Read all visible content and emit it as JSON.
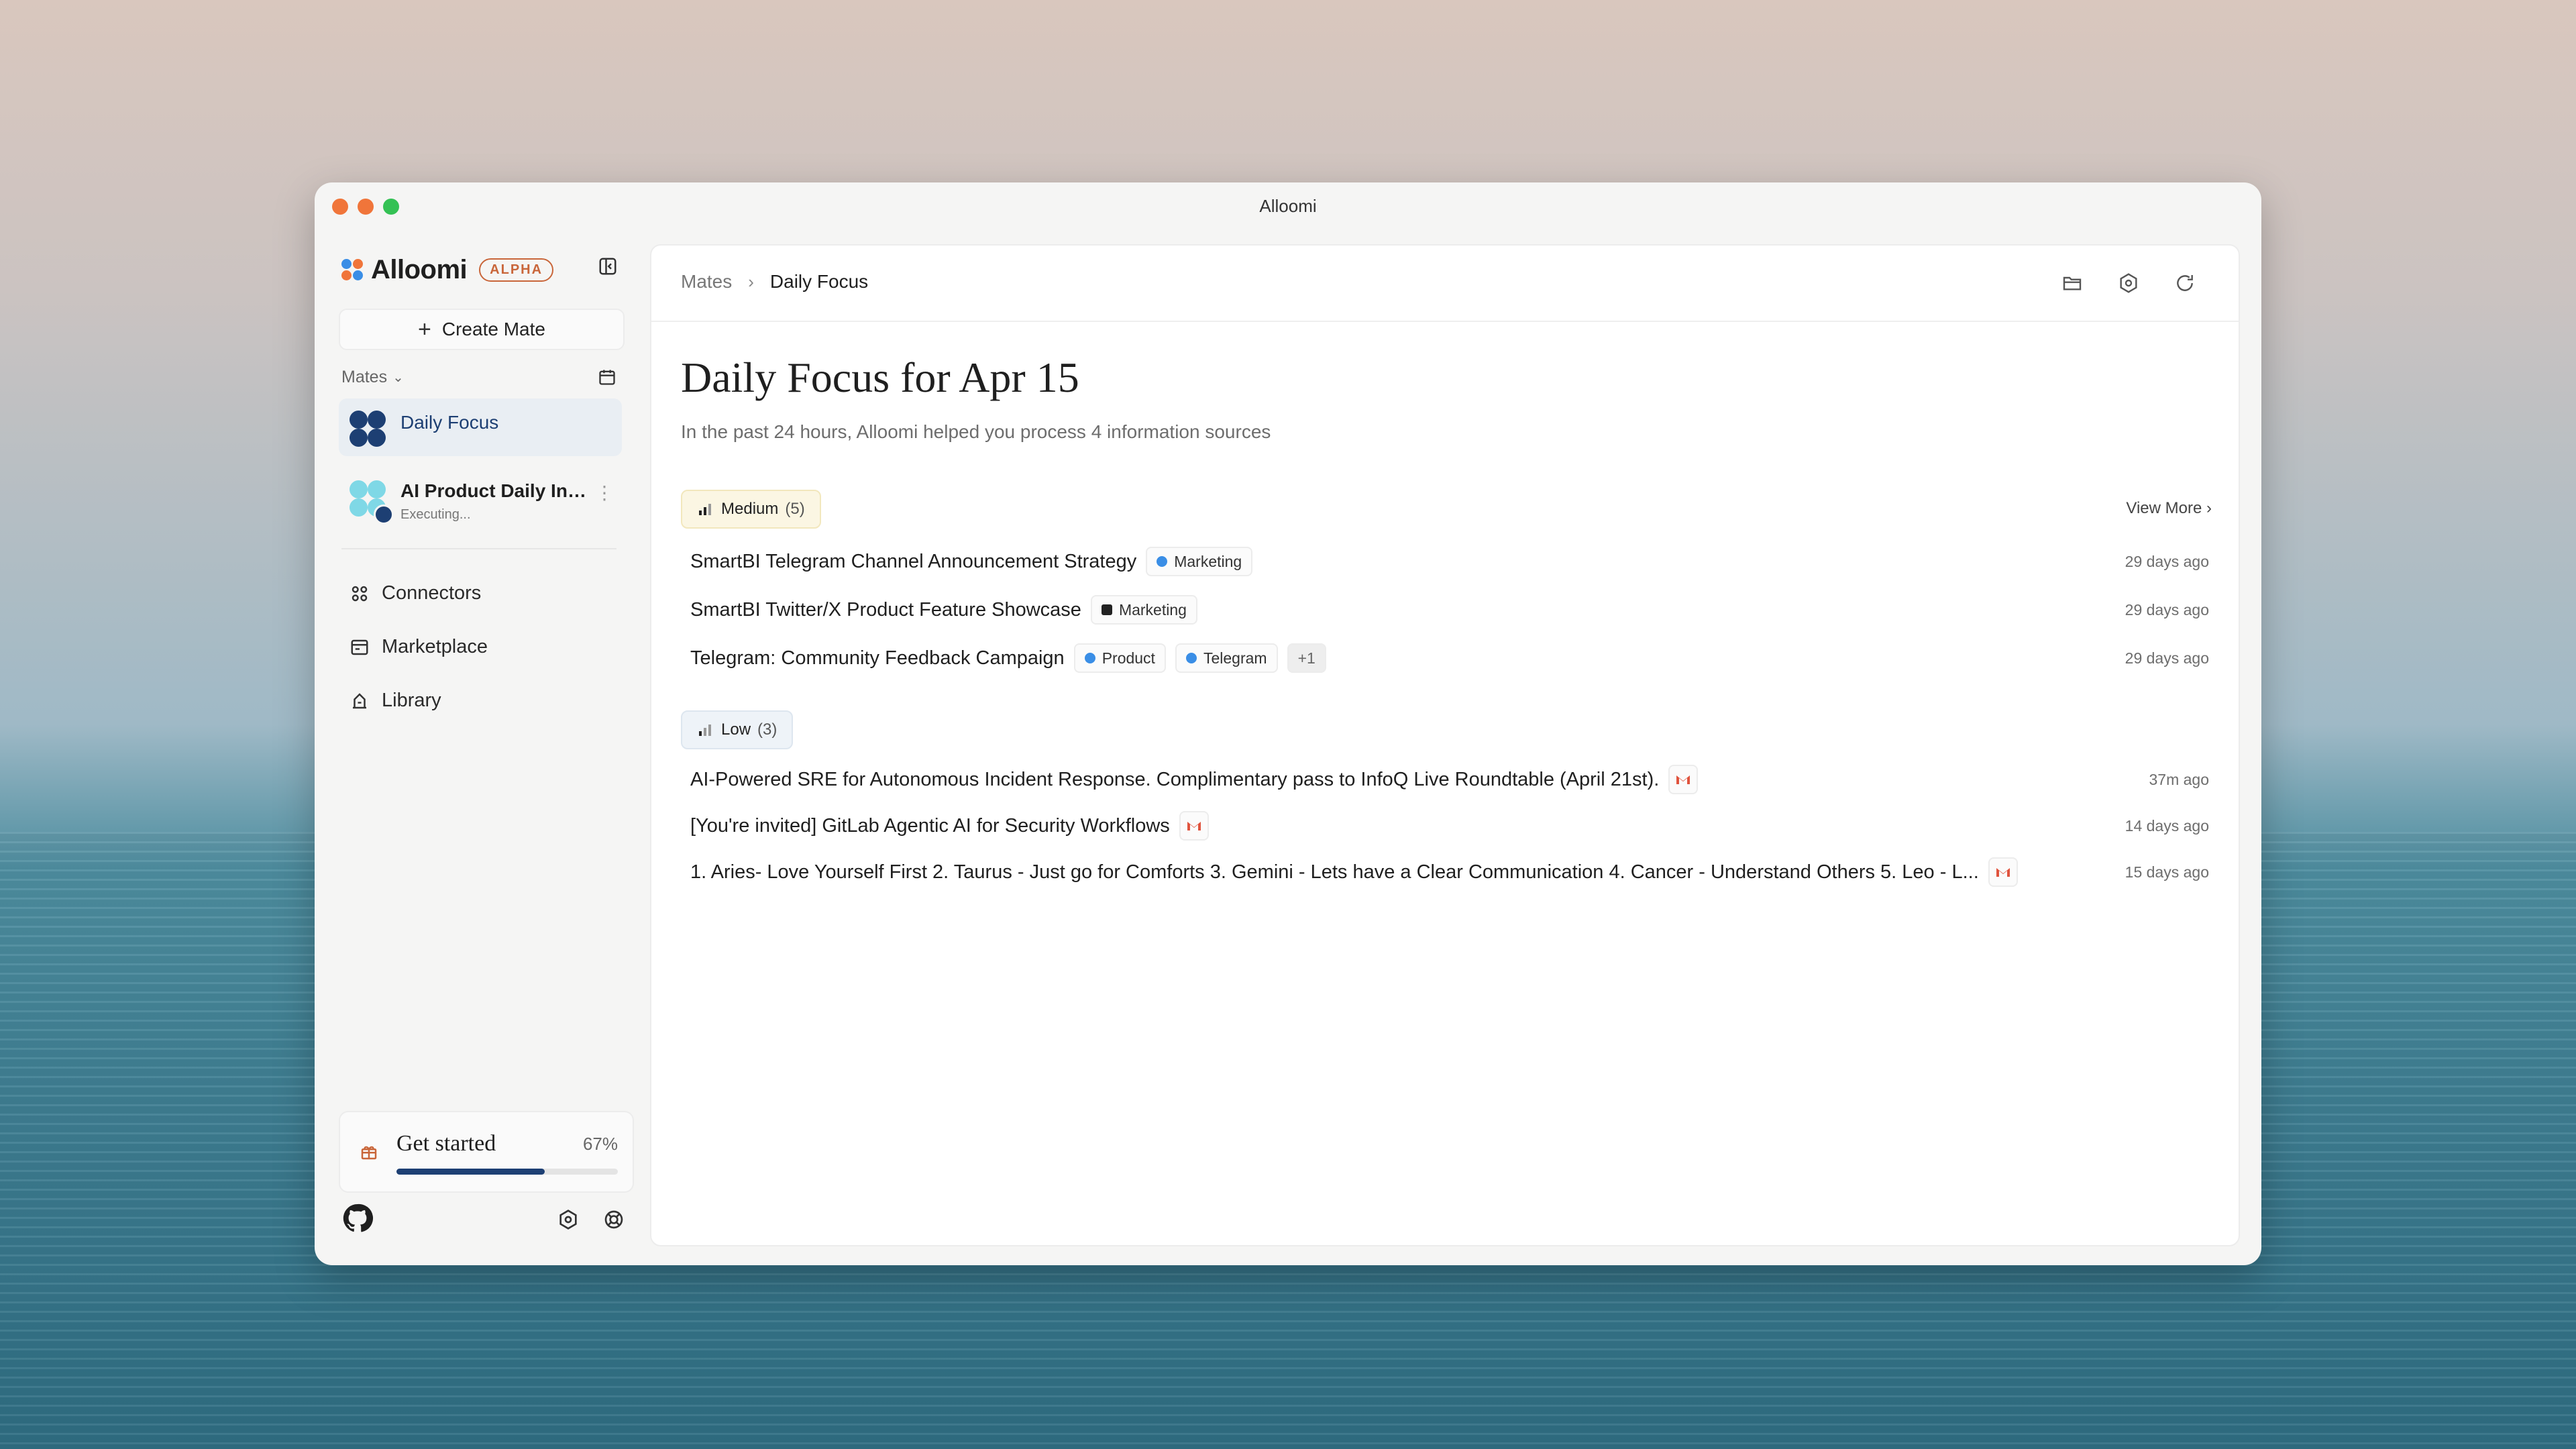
{
  "window": {
    "title": "Alloomi"
  },
  "sidebar": {
    "logo_text": "Alloomi",
    "badge": "ALPHA",
    "create_button": "Create Mate",
    "mates_label": "Mates",
    "mates": [
      {
        "name": "Daily Focus",
        "status": ""
      },
      {
        "name": "AI Product Daily Intelligence",
        "status": "Executing..."
      }
    ],
    "nav": [
      {
        "label": "Connectors",
        "icon": "connectors-icon"
      },
      {
        "label": "Marketplace",
        "icon": "marketplace-icon"
      },
      {
        "label": "Library",
        "icon": "library-icon"
      }
    ],
    "get_started": {
      "label": "Get started",
      "progress_label": "67%",
      "progress": 0.67
    }
  },
  "main": {
    "breadcrumb": {
      "root": "Mates",
      "current": "Daily Focus"
    },
    "title": "Daily Focus for Apr 15",
    "subtitle": "In the past 24 hours, Alloomi helped you process 4 information sources",
    "groups": [
      {
        "label": "Medium",
        "count": "(5)",
        "view_more": "View More",
        "items": [
          {
            "title": "SmartBI Telegram Channel Announcement Strategy",
            "tags": [
              "Marketing"
            ],
            "time": "29 days ago"
          },
          {
            "title": "SmartBI Twitter/X Product Feature Showcase",
            "tags": [
              "Marketing"
            ],
            "time": "29 days ago"
          },
          {
            "title": "Telegram: Community Feedback Campaign",
            "tags": [
              "Product",
              "Telegram",
              "+1"
            ],
            "time": "29 days ago"
          }
        ]
      },
      {
        "label": "Low",
        "count": "(3)",
        "items": [
          {
            "title": "AI-Powered SRE for Autonomous Incident Response. Complimentary pass to InfoQ Live Roundtable (April 21st).",
            "source": "gmail-icon",
            "time": "37m ago"
          },
          {
            "title": "[You're invited] GitLab Agentic AI for Security Workflows",
            "source": "gmail-icon",
            "time": "14 days ago"
          },
          {
            "title": "1. Aries- Love Yourself First 2. Taurus - Just go for Comforts 3. Gemini - Lets have a Clear Communication 4. Cancer - Understand Others 5. Leo - L...",
            "source": "gmail-icon",
            "time": "15 days ago"
          }
        ]
      }
    ]
  },
  "colors": {
    "accent": "#1d3f73",
    "alpha_badge": "#c9663a",
    "medium_chip": "#fbf6e3",
    "low_chip": "#eef3f8"
  }
}
